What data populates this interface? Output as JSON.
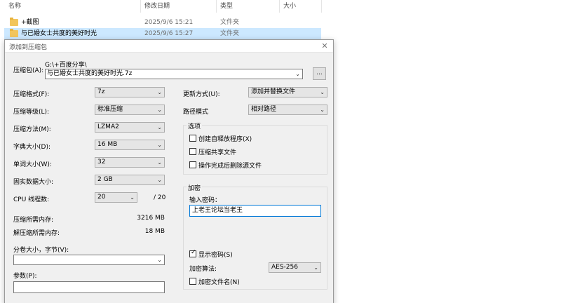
{
  "explorer": {
    "columns": {
      "name": "名称",
      "date": "修改日期",
      "type": "类型",
      "size": "大小"
    },
    "files": [
      {
        "name": "+截图",
        "date": "2025/9/6 15:21",
        "type": "文件夹"
      },
      {
        "name": "与已婚女士共度的美好时光",
        "date": "2025/9/6 15:27",
        "type": "文件夹"
      }
    ]
  },
  "dialog": {
    "title": "添加到压缩包",
    "archive_label": "压缩包(A):",
    "archive_path": "G:\\+百度分享\\",
    "archive_name": "与已婚女士共度的美好时光.7z",
    "browse_label": "...",
    "left": {
      "format_label": "压缩格式(F):",
      "format_value": "7z",
      "level_label": "压缩等级(L):",
      "level_value": "标准压缩",
      "method_label": "压缩方法(M):",
      "method_value": "LZMA2",
      "dict_label": "字典大小(D):",
      "dict_value": "16 MB",
      "word_label": "单词大小(W):",
      "word_value": "32",
      "solid_label": "固实数据大小:",
      "solid_value": "2 GB",
      "cpu_label": "CPU 线程数:",
      "cpu_value": "20",
      "cpu_total": "/ 20",
      "mem_comp_label": "压缩所需内存:",
      "mem_comp_value": "3216 MB",
      "mem_decomp_label": "解压缩所需内存:",
      "mem_decomp_value": "18 MB",
      "split_label": "分卷大小，字节(V):",
      "split_value": "",
      "params_label": "参数(P):",
      "params_value": ""
    },
    "right": {
      "update_label": "更新方式(U):",
      "update_value": "添加并替换文件",
      "path_label": "路径模式",
      "path_value": "相对路径",
      "options_title": "选项",
      "opt_sfx": "创建自释放程序(X)",
      "opt_shared": "压缩共享文件",
      "opt_delete": "操作完成后删除源文件",
      "encrypt_title": "加密",
      "password_label": "输入密码：",
      "password_value": "上老王论坛当老王",
      "show_password": "显示密码(S)",
      "enc_method_label": "加密算法:",
      "enc_method_value": "AES-256",
      "encrypt_names": "加密文件名(N)"
    }
  }
}
